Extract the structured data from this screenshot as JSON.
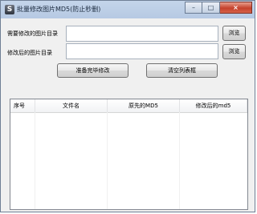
{
  "window": {
    "title": "批量修改图片MD5(防止秒删)",
    "minimize_glyph": "–",
    "maximize_glyph": "□",
    "close_glyph": "×"
  },
  "form": {
    "source_dir_label": "需要修改的图片目录",
    "source_dir_value": "",
    "dest_dir_label": "修改后的图片目录",
    "dest_dir_value": "",
    "browse_label": "浏览",
    "start_button_label": "准备完毕修改",
    "clear_button_label": "清空列表框"
  },
  "list": {
    "columns": [
      "序号",
      "文件名",
      "原先的MD5",
      "修改后的md5"
    ],
    "rows": []
  },
  "colors": {
    "titlebar": "#b9cce5",
    "close_button": "#c5412c",
    "client_background": "#f0f0f0"
  }
}
